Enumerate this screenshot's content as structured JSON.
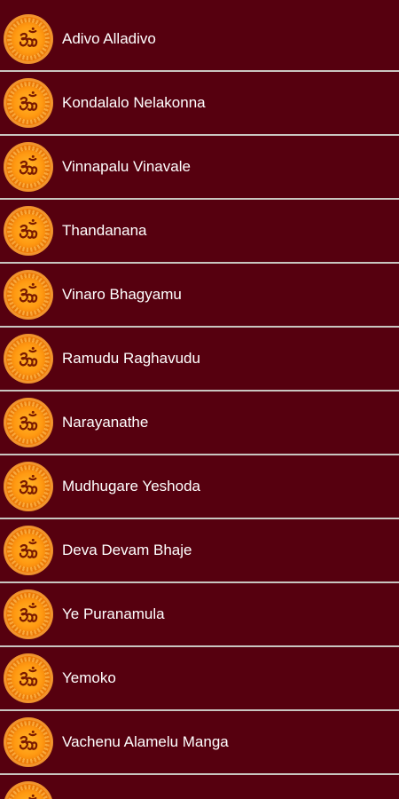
{
  "songs": [
    {
      "title": "Adivo Alladivo"
    },
    {
      "title": "Kondalalo Nelakonna"
    },
    {
      "title": "Vinnapalu Vinavale"
    },
    {
      "title": "Thandanana"
    },
    {
      "title": "Vinaro Bhagyamu"
    },
    {
      "title": "Ramudu Raghavudu"
    },
    {
      "title": "Narayanathe"
    },
    {
      "title": "Mudhugare Yeshoda"
    },
    {
      "title": "Deva Devam Bhaje"
    },
    {
      "title": "Ye Puranamula"
    },
    {
      "title": "Yemoko"
    },
    {
      "title": "Vachenu Alamelu Manga"
    },
    {
      "title": ""
    }
  ],
  "icon": "om-icon",
  "colors": {
    "background": "#56000f",
    "divider": "#c9c5c0",
    "text": "#ffffff",
    "icon_orange": "#ff9a12"
  }
}
